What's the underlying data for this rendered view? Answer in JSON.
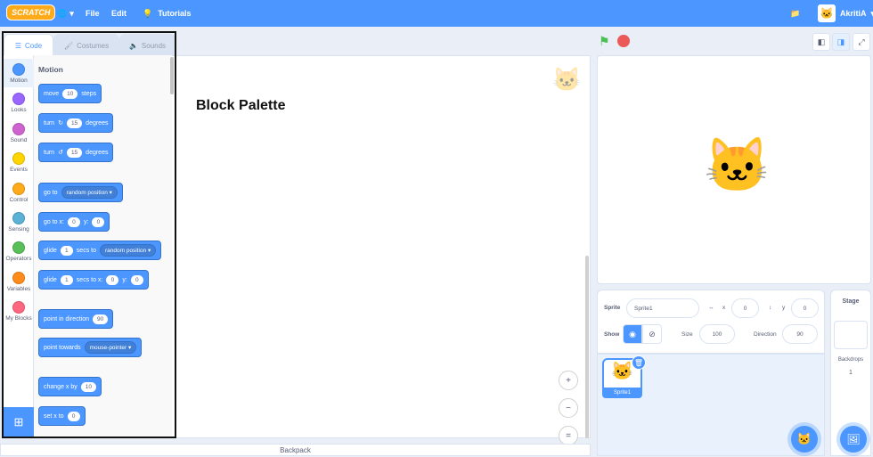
{
  "menubar": {
    "logo": "SCRATCH",
    "globe_icon": "globe-icon",
    "file": "File",
    "edit": "Edit",
    "tutorials": "Tutorials",
    "username": "AkritiA"
  },
  "tabs": {
    "code": "Code",
    "costumes": "Costumes",
    "sounds": "Sounds"
  },
  "categories": [
    {
      "label": "Motion",
      "color": "#4c97ff"
    },
    {
      "label": "Looks",
      "color": "#9966ff"
    },
    {
      "label": "Sound",
      "color": "#cf63cf"
    },
    {
      "label": "Events",
      "color": "#ffd500"
    },
    {
      "label": "Control",
      "color": "#ffab19"
    },
    {
      "label": "Sensing",
      "color": "#5cb1d6"
    },
    {
      "label": "Operators",
      "color": "#59c059"
    },
    {
      "label": "Variables",
      "color": "#ff8c1a"
    },
    {
      "label": "My Blocks",
      "color": "#ff6680"
    }
  ],
  "palette": {
    "title": "Motion",
    "move": {
      "a": "move",
      "v": "10",
      "b": "steps"
    },
    "turn_r": {
      "a": "turn",
      "v": "15",
      "b": "degrees"
    },
    "turn_l": {
      "a": "turn",
      "v": "15",
      "b": "degrees"
    },
    "goto": {
      "a": "go to",
      "dd": "random position"
    },
    "gotoxy": {
      "a": "go to x:",
      "x": "0",
      "b": "y:",
      "y": "0"
    },
    "glide1": {
      "a": "glide",
      "v": "1",
      "b": "secs to",
      "dd": "random position"
    },
    "glide2": {
      "a": "glide",
      "v": "1",
      "b": "secs to x:",
      "x": "0",
      "c": "y:",
      "y": "0"
    },
    "point_dir": {
      "a": "point in direction",
      "v": "90"
    },
    "point_towards": {
      "a": "point towards",
      "dd": "mouse-pointer"
    },
    "change_x": {
      "a": "change x by",
      "v": "10"
    },
    "set_x": {
      "a": "set x to",
      "v": "0"
    }
  },
  "workspace": {
    "annotation": "Block Palette"
  },
  "backpack": "Backpack",
  "sprite_info": {
    "sprite_label": "Sprite",
    "sprite_name": "Sprite1",
    "x_label": "x",
    "x_value": "0",
    "y_label": "y",
    "y_value": "0",
    "show_label": "Show",
    "size_label": "Size",
    "size_value": "100",
    "direction_label": "Direction",
    "direction_value": "90"
  },
  "sprite_list": {
    "thumb_label": "Sprite1"
  },
  "stage_panel": {
    "title": "Stage",
    "backdrops_label": "Backdrops",
    "backdrops_count": "1"
  }
}
